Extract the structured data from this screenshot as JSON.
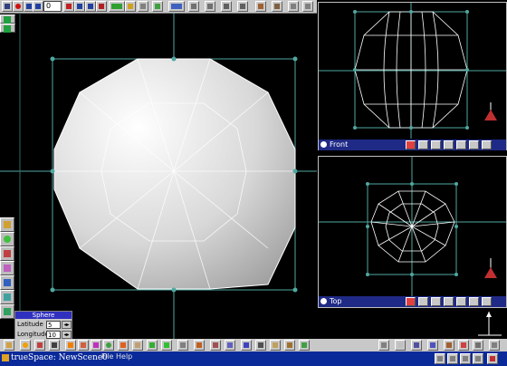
{
  "toolbar": {
    "frame_value": "0",
    "icons": [
      "rewind-icon",
      "record-icon",
      "play-reverse-icon",
      "prev-frame-icon",
      "next-frame-icon",
      "play-icon",
      "forward-icon",
      "animation-editor-icon",
      "object-select-icon",
      "paint-icon",
      "magnet-icon",
      "selection-icon",
      "render-icon",
      "move-icon",
      "rotate-icon",
      "scale-icon",
      "undo-icon",
      "redo-icon"
    ]
  },
  "viewports": {
    "front": {
      "title": "Front"
    },
    "top": {
      "title": "Top"
    }
  },
  "sphere_panel": {
    "title": "Sphere",
    "latitude_label": "Latitude",
    "latitude_value": "5",
    "longitude_label": "Longitude",
    "longitude_value": "10"
  },
  "taskbar": {
    "title": "trueSpace: NewScene0",
    "menu_file": "File",
    "menu_help": "Help"
  },
  "colors": {
    "taskbar": "#0a2a9a",
    "viewport_bar": "#1f2a86",
    "guide_lines": "#4fa8a0"
  }
}
